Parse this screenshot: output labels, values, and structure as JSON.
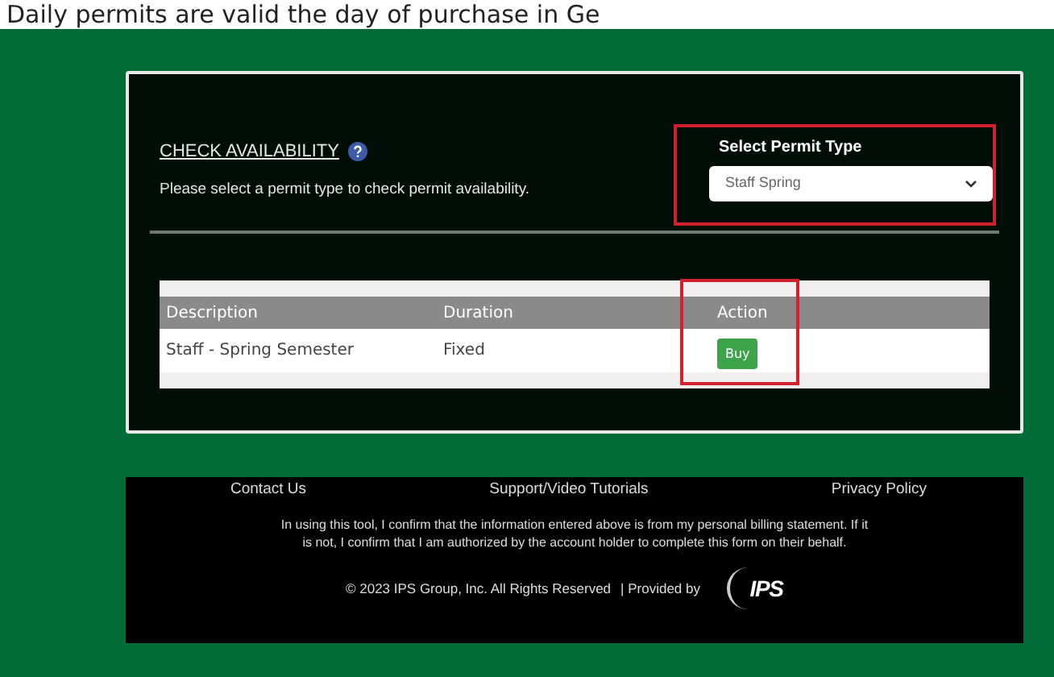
{
  "banner": "Daily permits are valid the day of purchase in Ge",
  "availability": {
    "title": "CHECK AVAILABILITY",
    "subtitle": "Please select a permit type to check permit availability."
  },
  "permit_select": {
    "label": "Select Permit Type",
    "value": "Staff Spring"
  },
  "table": {
    "columns": [
      "Description",
      "Duration",
      "Action"
    ],
    "rows": [
      {
        "description": "Staff - Spring Semester",
        "duration": "Fixed",
        "action": "Buy"
      }
    ]
  },
  "footer": {
    "links": [
      "Contact Us",
      "Support/Video Tutorials",
      "Privacy Policy"
    ],
    "notice": "In using this tool, I confirm that the information entered above is from my personal billing statement. If it is not, I confirm that I am authorized by the account holder to complete this form on their behalf.",
    "copyright": "© 2023 IPS Group, Inc. All Rights Reserved",
    "provided_by": "| Provided by",
    "logo": "IPS"
  }
}
